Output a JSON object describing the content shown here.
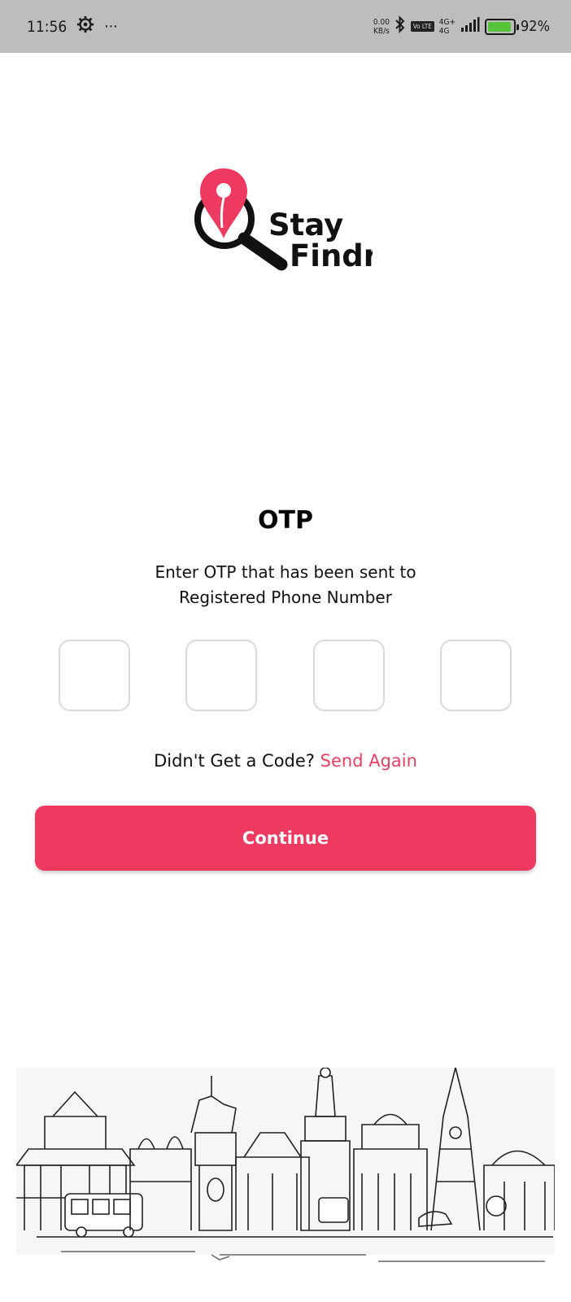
{
  "status_bar": {
    "time": "11:56",
    "more_dots": "···",
    "speed_value": "0.00",
    "speed_unit": "KB/s",
    "volte": "Vo LTE",
    "network_type": "4G+",
    "network_sub": "4G",
    "battery_percent": 92,
    "battery_text": "92%"
  },
  "logo": {
    "line1": "Stay",
    "line2": "Findr",
    "brand_color": "#ee3a60"
  },
  "otp": {
    "title": "OTP",
    "description_line1": "Enter OTP that has been sent to",
    "description_line2": "Registered Phone Number",
    "digits": [
      "",
      "",
      "",
      ""
    ]
  },
  "resend": {
    "prompt": "Didn't Get a Code?",
    "link": "Send Again"
  },
  "continue_button": {
    "label": "Continue"
  },
  "colors": {
    "accent": "#ee3a60",
    "box_border": "#d9d9d9",
    "status_bar_bg": "#bdbdbd"
  }
}
